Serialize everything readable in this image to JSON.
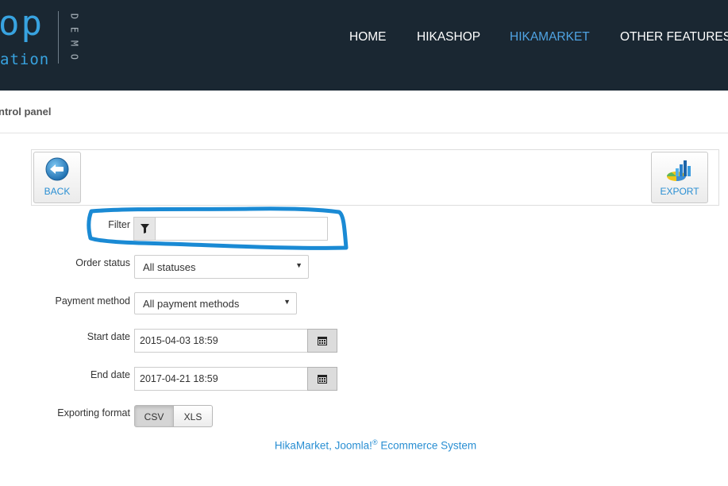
{
  "header": {
    "logo_main": "op",
    "logo_sub": "ation",
    "logo_demo": "DEMO",
    "nav": [
      {
        "label": "HOME",
        "active": false
      },
      {
        "label": "HIKASHOP",
        "active": false
      },
      {
        "label": "HIKAMARKET",
        "active": true
      },
      {
        "label": "OTHER FEATURES",
        "active": false
      }
    ]
  },
  "breadcrumb": "ntrol panel",
  "toolbar": {
    "back_label": "BACK",
    "export_label": "EXPORT"
  },
  "form": {
    "filter": {
      "label": "Filter",
      "value": "",
      "icon": "filter-icon"
    },
    "order_status": {
      "label": "Order status",
      "selected": "All statuses"
    },
    "payment_method": {
      "label": "Payment method",
      "selected": "All payment methods"
    },
    "start_date": {
      "label": "Start date",
      "value": "2015-04-03 18:59",
      "icon": "calendar-icon"
    },
    "end_date": {
      "label": "End date",
      "value": "2017-04-21 18:59",
      "icon": "calendar-icon"
    },
    "exporting_format": {
      "label": "Exporting format",
      "options": [
        "CSV",
        "XLS"
      ],
      "selected": "CSV"
    }
  },
  "footer": {
    "text": "HikaMarket, Joomla!",
    "reg": "®",
    "text2": " Ecommerce System"
  },
  "colors": {
    "header_bg": "#1a2732",
    "accent": "#2a8fd3",
    "annotation": "#1a8ad4"
  }
}
